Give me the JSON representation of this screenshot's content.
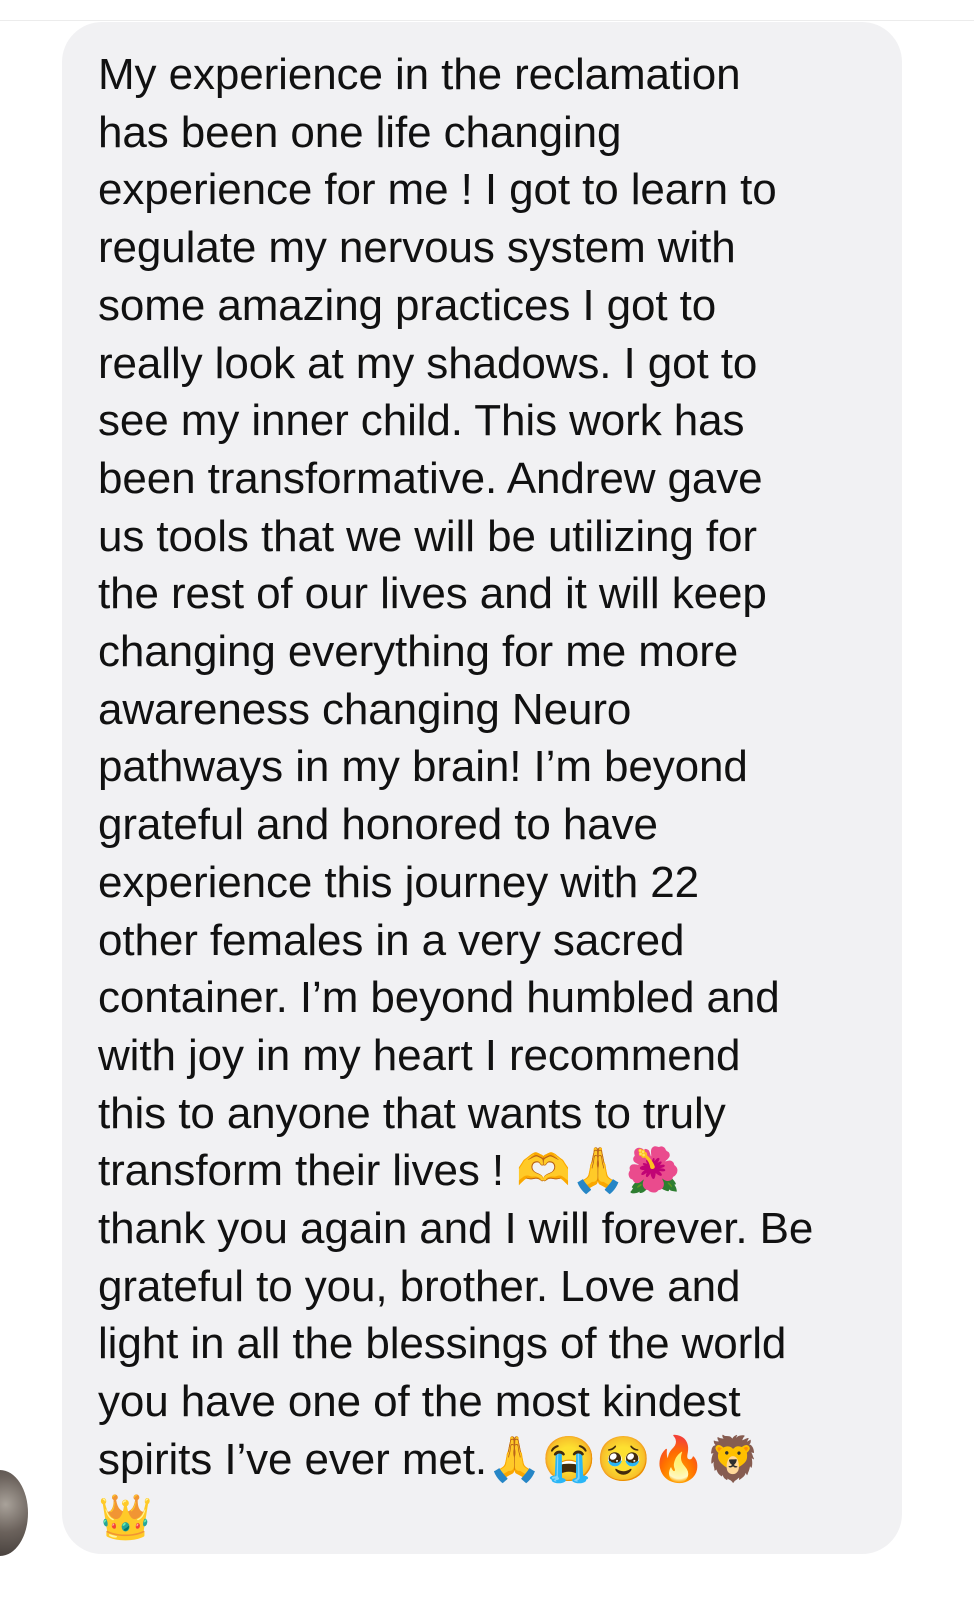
{
  "message": {
    "text": "My experience in the reclamation\nhas been one life changing\nexperience for me ! I got to learn to\nregulate my nervous system with\nsome amazing practices I got to\nreally look at my shadows. I got to\nsee my inner child. This work has\nbeen transformative. Andrew gave\nus tools that we will be utilizing for\nthe rest of our lives and it will keep\nchanging everything for me more\nawareness changing Neuro\npathways in my brain! I’m beyond\ngrateful and honored to have\nexperience this journey with 22\nother females in a very sacred\ncontainer. I’m beyond humbled and\nwith joy in my heart I recommend\nthis to anyone that wants to truly\ntransform their lives ! 🫶🙏🌺\nthank you again and I will forever. Be\ngrateful to you, brother. Love and\nlight in all the blessings of the world\nyou have one of the most kindest\nspirits I’ve ever met.🙏😭🥹🔥🦁\n👑"
  },
  "colors": {
    "bubble_background": "#f1f1f3",
    "text": "#111111",
    "page_background": "#ffffff"
  },
  "icons": {
    "avatar": "sender-avatar"
  }
}
